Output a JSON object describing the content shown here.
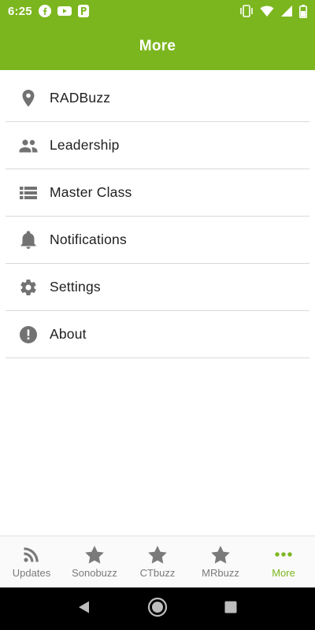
{
  "status_bar": {
    "time": "6:25",
    "left_icons": [
      "facebook-icon",
      "youtube-icon",
      "pandora-icon"
    ],
    "right_icons": [
      "vibrate-icon",
      "wifi-icon",
      "signal-icon",
      "battery-icon"
    ]
  },
  "app_bar": {
    "title": "More",
    "color": "#7cb61f"
  },
  "menu": {
    "items": [
      {
        "label": "RADBuzz",
        "icon": "location-pin-icon"
      },
      {
        "label": "Leadership",
        "icon": "people-icon"
      },
      {
        "label": "Master Class",
        "icon": "list-icon"
      },
      {
        "label": "Notifications",
        "icon": "bell-icon"
      },
      {
        "label": "Settings",
        "icon": "gear-icon"
      },
      {
        "label": "About",
        "icon": "info-icon"
      }
    ]
  },
  "bottom_nav": {
    "items": [
      {
        "label": "Updates",
        "icon": "rss-icon",
        "active": false
      },
      {
        "label": "Sonobuzz",
        "icon": "star-icon",
        "active": false
      },
      {
        "label": "CTbuzz",
        "icon": "star-icon",
        "active": false
      },
      {
        "label": "MRbuzz",
        "icon": "star-icon",
        "active": false
      },
      {
        "label": "More",
        "icon": "more-dots-icon",
        "active": true
      }
    ],
    "active_color": "#7cb61f",
    "inactive_color": "#7a7a7a"
  },
  "system_nav": {
    "buttons": [
      "back-icon",
      "home-icon",
      "recents-icon"
    ]
  }
}
